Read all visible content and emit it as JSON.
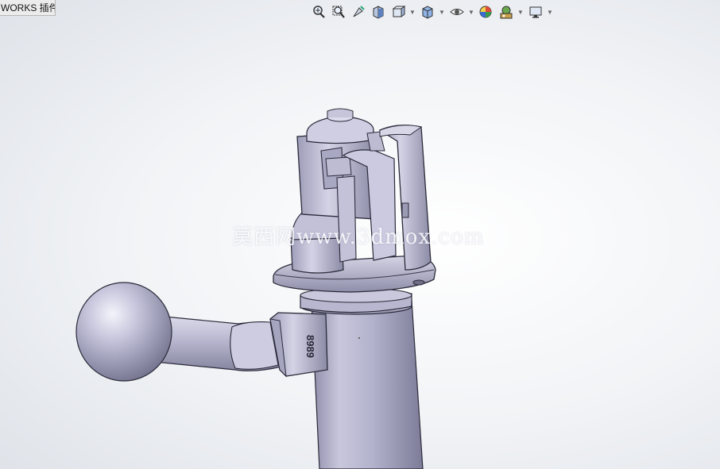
{
  "tab": {
    "label": "WORKS 插件"
  },
  "toolbar": {
    "buttons": [
      {
        "name": "zoom-to-fit-icon"
      },
      {
        "name": "zoom-to-area-icon"
      },
      {
        "name": "previous-view-icon"
      },
      {
        "name": "section-view-icon"
      },
      {
        "name": "view-orientation-icon"
      },
      {
        "name": "display-style-icon"
      },
      {
        "name": "hide-show-items-icon"
      },
      {
        "name": "edit-appearance-icon"
      },
      {
        "name": "apply-scene-icon"
      },
      {
        "name": "view-settings-icon"
      }
    ]
  },
  "model": {
    "engraving": "8989"
  },
  "watermark": {
    "text": "莫西网www.3dmox.com"
  }
}
